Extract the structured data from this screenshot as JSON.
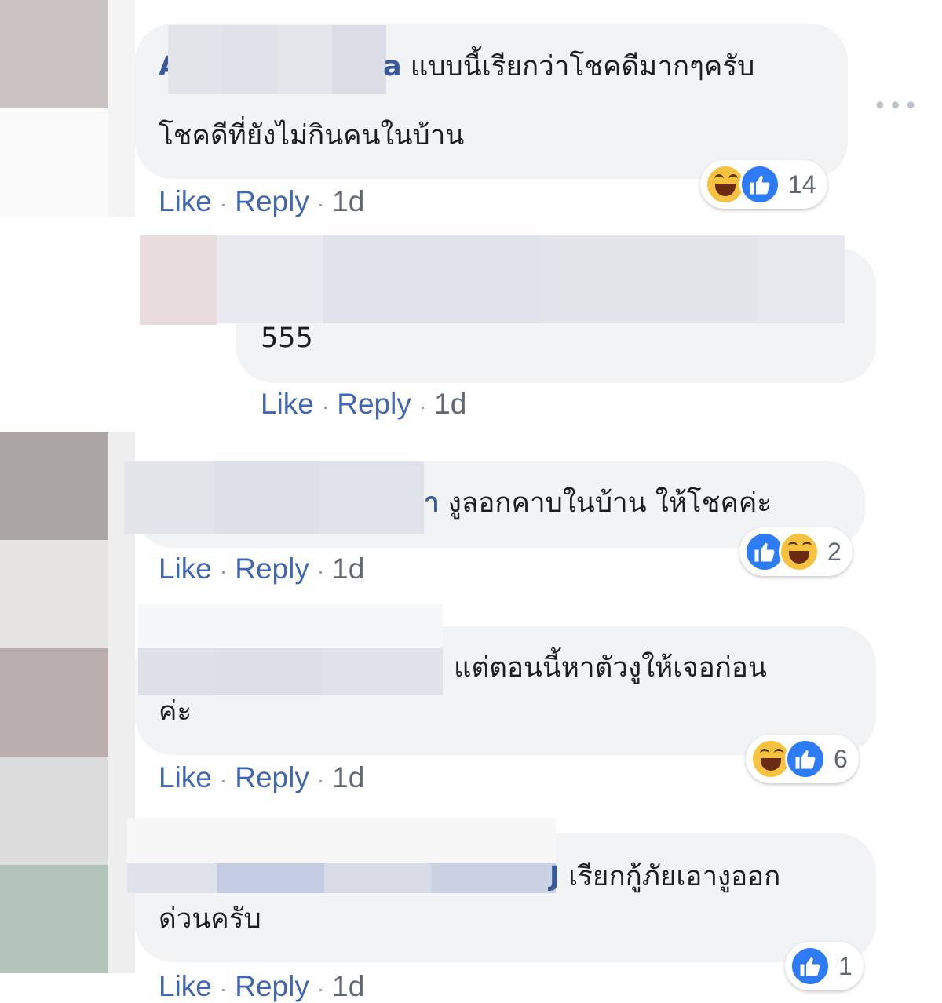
{
  "comments": [
    {
      "text_line1": "แบบนี้เรียกว่าโชคดีมากๆครับ",
      "text_line2": "โชคดีที่ยังไม่กินคนในบ้าน",
      "name_initial": "A",
      "name_tail": "a",
      "reactions": [
        "haha",
        "like"
      ],
      "reaction_count": "14",
      "actions": {
        "like": "Like",
        "reply": "Reply",
        "time": "1d"
      }
    },
    {
      "text_line1": "555",
      "actions": {
        "like": "Like",
        "reply": "Reply",
        "time": "1d"
      }
    },
    {
      "text_line1": "งูลอกคาบในบ้าน ให้โชคค่ะ",
      "name_tail": "า",
      "reactions": [
        "like",
        "haha"
      ],
      "reaction_count": "2",
      "actions": {
        "like": "Like",
        "reply": "Reply",
        "time": "1d"
      }
    },
    {
      "text_line1": "แต่ตอนนี้หาตัวงูให้เจอก่อน",
      "text_line2": "ค่ะ",
      "reactions": [
        "haha",
        "like"
      ],
      "reaction_count": "6",
      "actions": {
        "like": "Like",
        "reply": "Reply",
        "time": "1d"
      }
    },
    {
      "text_line1": "เรียกกู้ภัยเอางูออก",
      "text_line2": "ด่วนครับ",
      "name_tail": "J",
      "reactions": [
        "like"
      ],
      "reaction_count": "1",
      "actions": {
        "like": "Like",
        "reply": "Reply",
        "time": "1d"
      }
    }
  ],
  "more_icon": "more-horizontal-icon",
  "colors": {
    "bubble": "#f2f3f5",
    "link": "#4267b2",
    "author": "#385898",
    "like": "#2e7bf6",
    "haha": "#f7c240"
  }
}
